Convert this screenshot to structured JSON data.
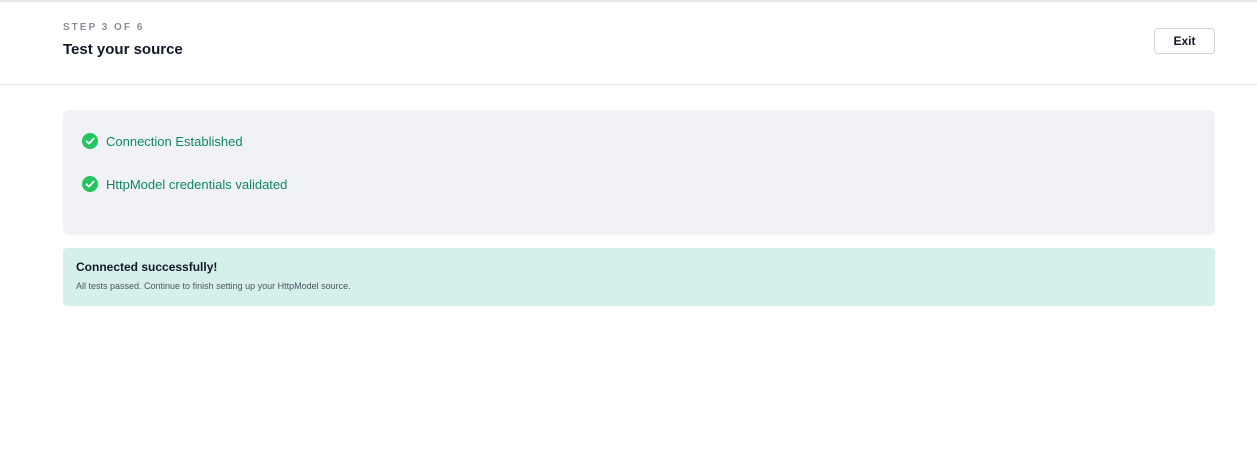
{
  "header": {
    "step_label": "STEP 3 OF 6",
    "title": "Test your source",
    "exit_label": "Exit"
  },
  "checks": {
    "items": [
      {
        "label": "Connection Established",
        "icon": "check-circle-icon",
        "status": "passed"
      },
      {
        "label": "HttpModel credentials validated",
        "icon": "check-circle-icon",
        "status": "passed"
      }
    ]
  },
  "result": {
    "title": "Connected successfully!",
    "message": "All tests passed. Continue to finish setting up your HttpModel source."
  },
  "colors": {
    "success_green": "#22c55e",
    "success_text": "#0f8a5f",
    "success_banner_bg": "#d5f0ea",
    "panel_bg": "#f0f2f5"
  }
}
